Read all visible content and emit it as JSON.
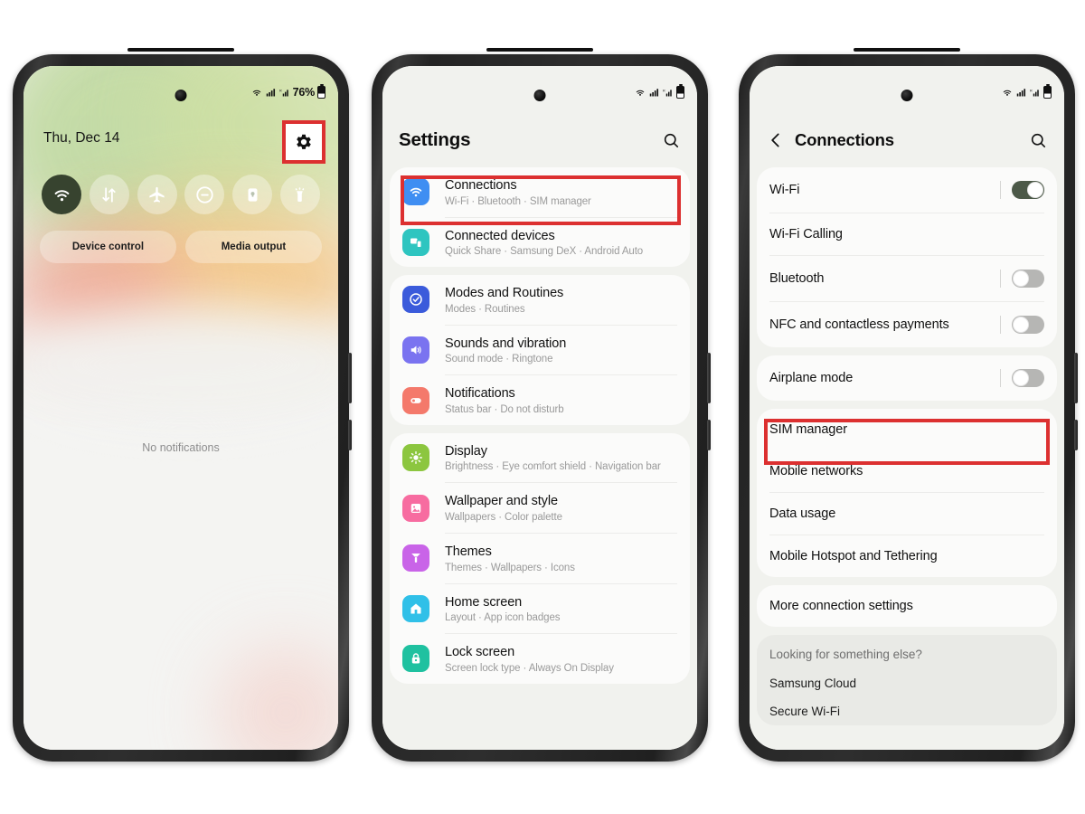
{
  "phone1": {
    "status": {
      "indicators": "wifi-icon, signal-icon, roaming-signal-icon",
      "battery_percent": "76%"
    },
    "date": "Thu, Dec 14",
    "gear_label": "gear-icon",
    "toggles": [
      {
        "name": "wifi",
        "label": "Wi-Fi",
        "state": "on"
      },
      {
        "name": "mobile-data",
        "label": "Mobile data",
        "state": "off"
      },
      {
        "name": "airplane-mode",
        "label": "Airplane mode",
        "state": "off"
      },
      {
        "name": "do-not-disturb",
        "label": "Do not disturb",
        "state": "off"
      },
      {
        "name": "auto-rotate-lock",
        "label": "Auto rotate",
        "state": "off"
      },
      {
        "name": "flashlight",
        "label": "Flashlight",
        "state": "off"
      }
    ],
    "chips": [
      {
        "label": "Device control"
      },
      {
        "label": "Media output"
      }
    ],
    "empty_text": "No notifications",
    "highlight": "gear-icon"
  },
  "phone2": {
    "status": {
      "indicators": "wifi-icon, signal-icon, roaming-signal-icon",
      "battery": "battery-icon"
    },
    "title": "Settings",
    "search_icon": "search-icon",
    "highlight": "Connections",
    "groups": [
      {
        "items": [
          {
            "title": "Connections",
            "sub": "Wi-Fi  ·  Bluetooth  ·  SIM manager",
            "icon": "wifi-icon",
            "color": "#3f8ef2",
            "highlighted": true
          },
          {
            "title": "Connected devices",
            "sub": "Quick Share  ·  Samsung DeX  ·  Android Auto",
            "icon": "devices-icon",
            "color": "#2ec5c0",
            "highlighted": false
          }
        ]
      },
      {
        "items": [
          {
            "title": "Modes and Routines",
            "sub": "Modes  ·  Routines",
            "icon": "check-circle-icon",
            "color": "#3b5bdb",
            "highlighted": false
          },
          {
            "title": "Sounds and vibration",
            "sub": "Sound mode  ·  Ringtone",
            "icon": "speaker-icon",
            "color": "#7a73f0",
            "highlighted": false
          },
          {
            "title": "Notifications",
            "sub": "Status bar  ·  Do not disturb",
            "icon": "bell-icon",
            "color": "#f4796b",
            "highlighted": false
          }
        ]
      },
      {
        "items": [
          {
            "title": "Display",
            "sub": "Brightness  ·  Eye comfort shield  ·  Navigation bar",
            "icon": "sun-icon",
            "color": "#8cc63f",
            "highlighted": false
          },
          {
            "title": "Wallpaper and style",
            "sub": "Wallpapers  ·  Color palette",
            "icon": "image-icon",
            "color": "#f76ca0",
            "highlighted": false
          },
          {
            "title": "Themes",
            "sub": "Themes  ·  Wallpapers  ·  Icons",
            "icon": "brush-icon",
            "color": "#c964e8",
            "highlighted": false
          },
          {
            "title": "Home screen",
            "sub": "Layout  ·  App icon badges",
            "icon": "home-icon",
            "color": "#30c0e8",
            "highlighted": false
          },
          {
            "title": "Lock screen",
            "sub": "Screen lock type  ·  Always On Display",
            "icon": "lock-icon",
            "color": "#1fc1a0",
            "highlighted": false
          }
        ]
      }
    ]
  },
  "phone3": {
    "status": {
      "indicators": "wifi-icon, signal-icon, roaming-signal-icon",
      "battery": "battery-icon"
    },
    "back_icon": "back-chevron-icon",
    "title": "Connections",
    "search_icon": "search-icon",
    "highlight": "SIM manager",
    "groups": [
      {
        "type": "toggles",
        "items": [
          {
            "label": "Wi-Fi",
            "toggle": "on"
          },
          {
            "label": "Wi-Fi Calling",
            "toggle": "none"
          },
          {
            "label": "Bluetooth",
            "toggle": "off"
          },
          {
            "label": "NFC and contactless payments",
            "toggle": "off"
          }
        ]
      },
      {
        "type": "toggles",
        "items": [
          {
            "label": "Airplane mode",
            "toggle": "off"
          }
        ]
      },
      {
        "type": "links",
        "items": [
          {
            "label": "SIM manager",
            "highlighted": true
          },
          {
            "label": "Mobile networks",
            "highlighted": false
          },
          {
            "label": "Data usage",
            "highlighted": false
          },
          {
            "label": "Mobile Hotspot and Tethering",
            "highlighted": false
          }
        ]
      },
      {
        "type": "links",
        "items": [
          {
            "label": "More connection settings",
            "highlighted": false
          }
        ]
      }
    ],
    "footer": {
      "heading": "Looking for something else?",
      "items": [
        {
          "label": "Samsung Cloud"
        },
        {
          "label": "Secure Wi-Fi"
        }
      ]
    }
  },
  "theme": {
    "highlight_color": "#dc3030",
    "toggle_on_color": "#4c5948",
    "toggle_off_color": "#b6b6b4",
    "screen_bg": "#f1f2ee",
    "card_bg": "#fbfbfa"
  }
}
